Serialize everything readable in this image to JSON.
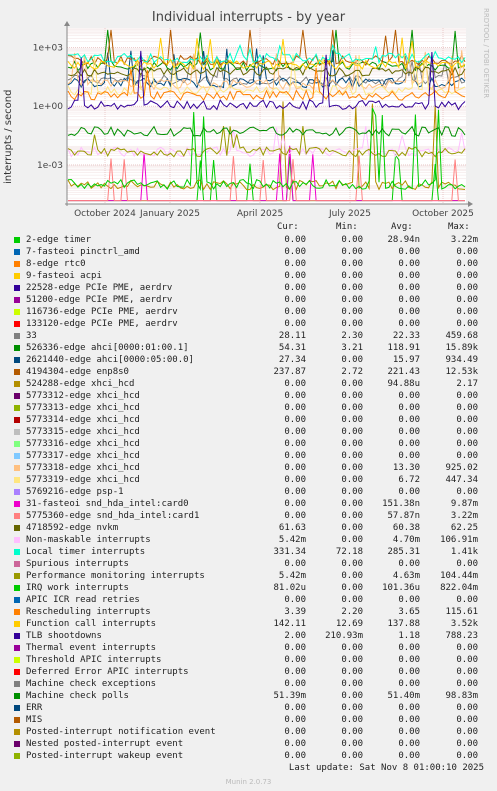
{
  "side_tag": "RRDTOOL / TOBI OETIKER",
  "chart_data": {
    "type": "line",
    "title": "Individual interrupts - by year",
    "ylabel": "interrupts / second",
    "y_scale": "log",
    "ylim": [
      1e-05,
      10000
    ],
    "y_ticks": [
      "1e+03",
      "1e+00",
      "1e-03"
    ],
    "x_ticks": [
      "October 2024",
      "January 2025",
      "April 2025",
      "July 2025",
      "October 2025"
    ],
    "grid": true,
    "series": [
      {
        "name": "2-edge timer",
        "color": "#00cc00",
        "cur": "0.00",
        "min": "0.00",
        "avg": "28.94n",
        "max": "3.22m"
      },
      {
        "name": "7-fasteoi pinctrl_amd",
        "color": "#0066b3",
        "cur": "0.00",
        "min": "0.00",
        "avg": "0.00",
        "max": "0.00"
      },
      {
        "name": "8-edge rtc0",
        "color": "#ff8000",
        "cur": "0.00",
        "min": "0.00",
        "avg": "0.00",
        "max": "0.00"
      },
      {
        "name": "9-fasteoi acpi",
        "color": "#ffcc00",
        "cur": "0.00",
        "min": "0.00",
        "avg": "0.00",
        "max": "0.00"
      },
      {
        "name": "22528-edge PCIe PME, aerdrv",
        "color": "#330099",
        "cur": "0.00",
        "min": "0.00",
        "avg": "0.00",
        "max": "0.00"
      },
      {
        "name": "51200-edge PCIe PME, aerdrv",
        "color": "#990099",
        "cur": "0.00",
        "min": "0.00",
        "avg": "0.00",
        "max": "0.00"
      },
      {
        "name": "116736-edge PCIe PME, aerdrv",
        "color": "#ccff00",
        "cur": "0.00",
        "min": "0.00",
        "avg": "0.00",
        "max": "0.00"
      },
      {
        "name": "133120-edge PCIe PME, aerdrv",
        "color": "#ff0000",
        "cur": "0.00",
        "min": "0.00",
        "avg": "0.00",
        "max": "0.00"
      },
      {
        "name": "33",
        "color": "#808080",
        "cur": "28.11",
        "min": "2.30",
        "avg": "22.33",
        "max": "459.68"
      },
      {
        "name": "526336-edge ahci[0000:01:00.1]",
        "color": "#008f00",
        "cur": "54.31",
        "min": "3.21",
        "avg": "118.91",
        "max": "15.89k"
      },
      {
        "name": "2621440-edge ahci[0000:05:00.0]",
        "color": "#00487d",
        "cur": "27.34",
        "min": "0.00",
        "avg": "15.97",
        "max": "934.49"
      },
      {
        "name": "4194304-edge enp8s0",
        "color": "#b35a00",
        "cur": "237.87",
        "min": "2.72",
        "avg": "221.43",
        "max": "12.53k"
      },
      {
        "name": "524288-edge xhci_hcd",
        "color": "#b38f00",
        "cur": "0.00",
        "min": "0.00",
        "avg": "94.88u",
        "max": "2.17"
      },
      {
        "name": "5773312-edge xhci_hcd",
        "color": "#6b006b",
        "cur": "0.00",
        "min": "0.00",
        "avg": "0.00",
        "max": "0.00"
      },
      {
        "name": "5773313-edge xhci_hcd",
        "color": "#8fb300",
        "cur": "0.00",
        "min": "0.00",
        "avg": "0.00",
        "max": "0.00"
      },
      {
        "name": "5773314-edge xhci_hcd",
        "color": "#b30000",
        "cur": "0.00",
        "min": "0.00",
        "avg": "0.00",
        "max": "0.00"
      },
      {
        "name": "5773315-edge xhci_hcd",
        "color": "#bebebe",
        "cur": "0.00",
        "min": "0.00",
        "avg": "0.00",
        "max": "0.00"
      },
      {
        "name": "5773316-edge xhci_hcd",
        "color": "#80ff80",
        "cur": "0.00",
        "min": "0.00",
        "avg": "0.00",
        "max": "0.00"
      },
      {
        "name": "5773317-edge xhci_hcd",
        "color": "#80c9ff",
        "cur": "0.00",
        "min": "0.00",
        "avg": "0.00",
        "max": "0.00"
      },
      {
        "name": "5773318-edge xhci_hcd",
        "color": "#ffc080",
        "cur": "0.00",
        "min": "0.00",
        "avg": "13.30",
        "max": "925.02"
      },
      {
        "name": "5773319-edge xhci_hcd",
        "color": "#ffe680",
        "cur": "0.00",
        "min": "0.00",
        "avg": "6.72",
        "max": "447.34"
      },
      {
        "name": "5769216-edge psp-1",
        "color": "#aa80ff",
        "cur": "0.00",
        "min": "0.00",
        "avg": "0.00",
        "max": "0.00"
      },
      {
        "name": "31-fasteoi snd_hda_intel:card0",
        "color": "#ee00cc",
        "cur": "0.00",
        "min": "0.00",
        "avg": "151.38n",
        "max": "9.87m"
      },
      {
        "name": "5775360-edge snd_hda_intel:card1",
        "color": "#ff8080",
        "cur": "0.00",
        "min": "0.00",
        "avg": "57.87n",
        "max": "3.22m"
      },
      {
        "name": "4718592-edge nvkm",
        "color": "#666600",
        "cur": "61.63",
        "min": "0.00",
        "avg": "60.38",
        "max": "62.25"
      },
      {
        "name": "Non-maskable interrupts",
        "color": "#ffbfff",
        "cur": "5.42m",
        "min": "0.00",
        "avg": "4.70m",
        "max": "106.91m"
      },
      {
        "name": "Local timer interrupts",
        "color": "#00ffcc",
        "cur": "331.34",
        "min": "72.18",
        "avg": "285.31",
        "max": "1.41k"
      },
      {
        "name": "Spurious interrupts",
        "color": "#cc6699",
        "cur": "0.00",
        "min": "0.00",
        "avg": "0.00",
        "max": "0.00"
      },
      {
        "name": "Performance monitoring interrupts",
        "color": "#999900",
        "cur": "5.42m",
        "min": "0.00",
        "avg": "4.63m",
        "max": "104.44m"
      },
      {
        "name": "IRQ work interrupts",
        "color": "#00cc00",
        "cur": "81.02u",
        "min": "0.00",
        "avg": "101.36u",
        "max": "822.04m"
      },
      {
        "name": "APIC ICR read retries",
        "color": "#0066b3",
        "cur": "0.00",
        "min": "0.00",
        "avg": "0.00",
        "max": "0.00"
      },
      {
        "name": "Rescheduling interrupts",
        "color": "#ff8000",
        "cur": "3.39",
        "min": "2.20",
        "avg": "3.65",
        "max": "115.61"
      },
      {
        "name": "Function call interrupts",
        "color": "#ffcc00",
        "cur": "142.11",
        "min": "12.69",
        "avg": "137.88",
        "max": "3.52k"
      },
      {
        "name": "TLB shootdowns",
        "color": "#330099",
        "cur": "2.00",
        "min": "210.93m",
        "avg": "1.18",
        "max": "788.23"
      },
      {
        "name": "Thermal event interrupts",
        "color": "#990099",
        "cur": "0.00",
        "min": "0.00",
        "avg": "0.00",
        "max": "0.00"
      },
      {
        "name": "Threshold APIC interrupts",
        "color": "#ccff00",
        "cur": "0.00",
        "min": "0.00",
        "avg": "0.00",
        "max": "0.00"
      },
      {
        "name": "Deferred Error APIC interrupts",
        "color": "#ff0000",
        "cur": "0.00",
        "min": "0.00",
        "avg": "0.00",
        "max": "0.00"
      },
      {
        "name": "Machine check exceptions",
        "color": "#808080",
        "cur": "0.00",
        "min": "0.00",
        "avg": "0.00",
        "max": "0.00"
      },
      {
        "name": "Machine check polls",
        "color": "#008f00",
        "cur": "51.39m",
        "min": "0.00",
        "avg": "51.40m",
        "max": "98.83m"
      },
      {
        "name": "ERR",
        "color": "#00487d",
        "cur": "0.00",
        "min": "0.00",
        "avg": "0.00",
        "max": "0.00"
      },
      {
        "name": "MIS",
        "color": "#b35a00",
        "cur": "0.00",
        "min": "0.00",
        "avg": "0.00",
        "max": "0.00"
      },
      {
        "name": "Posted-interrupt notification event",
        "color": "#b38f00",
        "cur": "0.00",
        "min": "0.00",
        "avg": "0.00",
        "max": "0.00"
      },
      {
        "name": "Nested posted-interrupt event",
        "color": "#6b006b",
        "cur": "0.00",
        "min": "0.00",
        "avg": "0.00",
        "max": "0.00"
      },
      {
        "name": "Posted-interrupt wakeup event",
        "color": "#8fb300",
        "cur": "0.00",
        "min": "0.00",
        "avg": "0.00",
        "max": "0.00"
      }
    ]
  },
  "legend_header": {
    "cur": "Cur:",
    "min": "Min:",
    "avg": "Avg:",
    "max": "Max:"
  },
  "last_update": "Last update: Sat Nov  8 01:00:10 2025",
  "footer": "Munin 2.0.73"
}
